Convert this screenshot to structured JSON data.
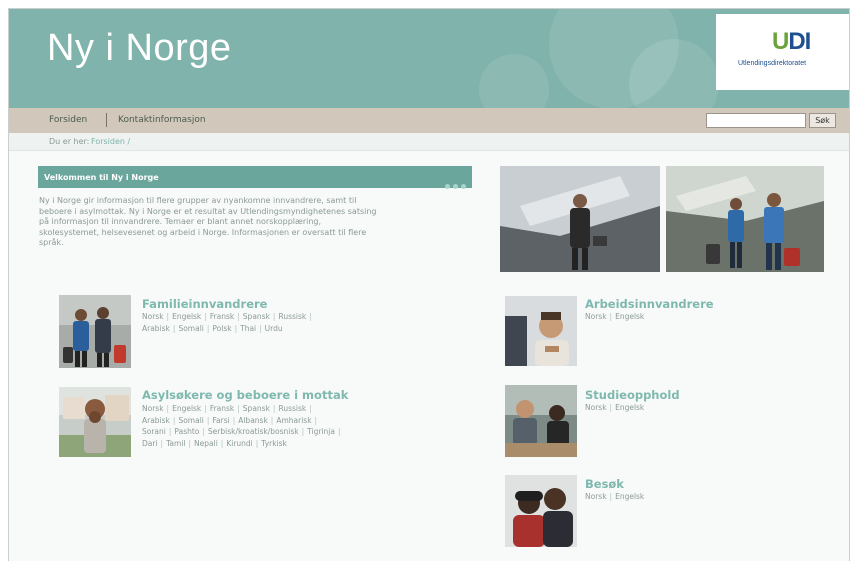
{
  "header": {
    "title": "Ny i Norge",
    "logo_text_u": "U",
    "logo_text_di": "DI",
    "logo_subtitle": "Utlendingsdirektoratet"
  },
  "nav": {
    "links": [
      "Forsiden",
      "Kontaktinformasjon"
    ]
  },
  "search": {
    "value": "",
    "button_label": "Søk"
  },
  "breadcrumb": {
    "label": "Du er her:",
    "link": "Forsiden /"
  },
  "intro": {
    "title": "Velkommen til Ny i Norge",
    "lines": [
      "Ny i Norge gir informasjon til flere grupper av nyankomne innvandrere, samt til",
      "beboere i asylmottak. Ny i Norge er et resultat av Utlendingsmyndighetenes satsing",
      "på informasjon til innvandrere. Temaer er blant annet norskopplæring,",
      "skolesystemet, helsevesenet og arbeid i Norge. Informasjonen er oversatt til flere",
      "språk."
    ]
  },
  "categories": {
    "familie": {
      "title": "Familieinnvandrere",
      "rows": [
        [
          "Norsk",
          "Engelsk",
          "Fransk",
          "Spansk",
          "Russisk"
        ],
        [
          "Arabisk",
          "Somali",
          "Polsk",
          "Thai",
          "Urdu"
        ]
      ]
    },
    "asyl": {
      "title": "Asylsøkere og beboere i mottak",
      "rows": [
        [
          "Norsk",
          "Engelsk",
          "Fransk",
          "Spansk",
          "Russisk"
        ],
        [
          "Arabisk",
          "Somali",
          "Farsi",
          "Albansk",
          "Amharisk"
        ],
        [
          "Sorani",
          "Pashto",
          "Serbisk/kroatisk/bosnisk",
          "Tigrinja"
        ],
        [
          "Dari",
          "Tamil",
          "Nepali",
          "Kirundi",
          "Tyrkisk"
        ]
      ]
    },
    "arbeid": {
      "title": "Arbeidsinnvandrere",
      "rows": [
        [
          "Norsk",
          "Engelsk"
        ]
      ]
    },
    "studie": {
      "title": "Studieopphold",
      "rows": [
        [
          "Norsk",
          "Engelsk"
        ]
      ]
    },
    "besok": {
      "title": "Besøk",
      "rows": [
        [
          "Norsk",
          "Engelsk"
        ]
      ]
    }
  },
  "colors": {
    "header_teal": "#7fb3ab",
    "accent_teal": "#6ba69c",
    "nav_beige": "#d1c7bb",
    "link_teal": "#7fb8ae"
  }
}
